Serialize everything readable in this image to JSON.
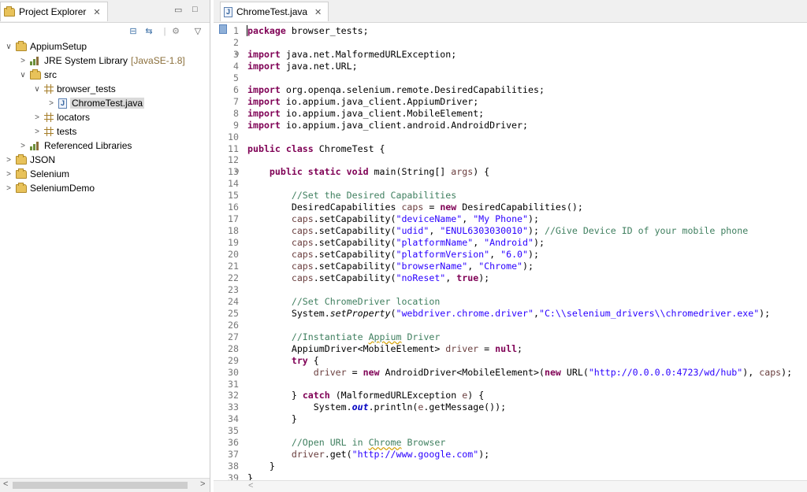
{
  "explorer": {
    "tab_label": "Project Explorer",
    "tree": [
      {
        "label": "AppiumSetup",
        "arrow": "∨",
        "type": "project",
        "depth": 0
      },
      {
        "label": "JRE System Library",
        "suffix": "[JavaSE-1.8]",
        "arrow": ">",
        "type": "library",
        "depth": 1
      },
      {
        "label": "src",
        "arrow": "∨",
        "type": "srcfolder",
        "depth": 1
      },
      {
        "label": "browser_tests",
        "arrow": "∨",
        "type": "package",
        "depth": 2
      },
      {
        "label": "ChromeTest.java",
        "arrow": ">",
        "type": "java",
        "depth": 3,
        "selected": true
      },
      {
        "label": "locators",
        "arrow": ">",
        "type": "package",
        "depth": 2
      },
      {
        "label": "tests",
        "arrow": ">",
        "type": "package",
        "depth": 2
      },
      {
        "label": "Referenced Libraries",
        "arrow": ">",
        "type": "library",
        "depth": 1
      },
      {
        "label": "JSON",
        "arrow": ">",
        "type": "project",
        "depth": 0
      },
      {
        "label": "Selenium",
        "arrow": ">",
        "type": "project",
        "depth": 0
      },
      {
        "label": "SeleniumDemo",
        "arrow": ">",
        "type": "project",
        "depth": 0
      }
    ]
  },
  "editor": {
    "tab_label": "ChromeTest.java",
    "lines": [
      {
        "n": "1",
        "html": "<span class=\"kw cursor\">package</span> browser_tests;"
      },
      {
        "n": "2",
        "html": ""
      },
      {
        "n": "3",
        "fold": "⊖",
        "html": "<span class=\"kw\">import</span> java.net.MalformedURLException;"
      },
      {
        "n": "4",
        "html": "<span class=\"kw\">import</span> java.net.URL;"
      },
      {
        "n": "5",
        "html": ""
      },
      {
        "n": "6",
        "html": "<span class=\"kw\">import</span> org.openqa.selenium.remote.DesiredCapabilities;"
      },
      {
        "n": "7",
        "html": "<span class=\"kw\">import</span> io.appium.java_client.AppiumDriver;"
      },
      {
        "n": "8",
        "html": "<span class=\"kw\">import</span> io.appium.java_client.MobileElement;"
      },
      {
        "n": "9",
        "html": "<span class=\"kw\">import</span> io.appium.java_client.android.AndroidDriver;"
      },
      {
        "n": "10",
        "html": ""
      },
      {
        "n": "11",
        "html": "<span class=\"kw\">public class</span> ChromeTest {"
      },
      {
        "n": "12",
        "html": ""
      },
      {
        "n": "13",
        "fold": "⊖",
        "html": "    <span class=\"kw\">public static void</span> main(String[] <span class=\"var\">args</span>) {"
      },
      {
        "n": "14",
        "html": ""
      },
      {
        "n": "15",
        "html": "        <span class=\"cm\">//Set the Desired Capabilities</span>"
      },
      {
        "n": "16",
        "html": "        DesiredCapabilities <span class=\"var\">caps</span> = <span class=\"kw\">new</span> DesiredCapabilities();"
      },
      {
        "n": "17",
        "html": "        <span class=\"var\">caps</span>.setCapability(<span class=\"str\">\"deviceName\"</span>, <span class=\"str\">\"My Phone\"</span>);"
      },
      {
        "n": "18",
        "html": "        <span class=\"var\">caps</span>.setCapability(<span class=\"str\">\"udid\"</span>, <span class=\"str\">\"ENUL6303030010\"</span>); <span class=\"cm\">//Give Device ID of your mobile phone</span>"
      },
      {
        "n": "19",
        "html": "        <span class=\"var\">caps</span>.setCapability(<span class=\"str\">\"platformName\"</span>, <span class=\"str\">\"Android\"</span>);"
      },
      {
        "n": "20",
        "html": "        <span class=\"var\">caps</span>.setCapability(<span class=\"str\">\"platformVersion\"</span>, <span class=\"str\">\"6.0\"</span>);"
      },
      {
        "n": "21",
        "html": "        <span class=\"var\">caps</span>.setCapability(<span class=\"str\">\"browserName\"</span>, <span class=\"str\">\"Chrome\"</span>);"
      },
      {
        "n": "22",
        "html": "        <span class=\"var\">caps</span>.setCapability(<span class=\"str\">\"noReset\"</span>, <span class=\"kw\">true</span>);"
      },
      {
        "n": "23",
        "html": ""
      },
      {
        "n": "24",
        "html": "        <span class=\"cm\">//Set ChromeDriver location</span>"
      },
      {
        "n": "25",
        "html": "        System.<span class=\"it\">setProperty</span>(<span class=\"str\">\"webdriver.chrome.driver\"</span>,<span class=\"str\">\"C:\\\\selenium_drivers\\\\chromedriver.exe\"</span>);"
      },
      {
        "n": "26",
        "html": ""
      },
      {
        "n": "27",
        "html": "        <span class=\"cm\">//Instantiate <span class=\"sp\">Appium</span> Driver</span>"
      },
      {
        "n": "28",
        "html": "        AppiumDriver&lt;MobileElement&gt; <span class=\"var\">driver</span> = <span class=\"kw\">null</span>;"
      },
      {
        "n": "29",
        "html": "        <span class=\"kw\">try</span> {"
      },
      {
        "n": "30",
        "html": "            <span class=\"var\">driver</span> = <span class=\"kw\">new</span> AndroidDriver&lt;MobileElement&gt;(<span class=\"kw\">new</span> URL(<span class=\"str\">\"http://0.0.0.0:4723/wd/hub\"</span>), <span class=\"var\">caps</span>);"
      },
      {
        "n": "31",
        "html": ""
      },
      {
        "n": "32",
        "html": "        } <span class=\"kw\">catch</span> (MalformedURLException <span class=\"var\">e</span>) {"
      },
      {
        "n": "33",
        "html": "            System.<span class=\"fld\">out</span>.println(<span class=\"var\">e</span>.getMessage());"
      },
      {
        "n": "34",
        "html": "        }"
      },
      {
        "n": "35",
        "html": ""
      },
      {
        "n": "36",
        "html": "        <span class=\"cm\">//Open URL in <span class=\"sp\">Chrome</span> Browser</span>"
      },
      {
        "n": "37",
        "html": "        <span class=\"var\">driver</span>.get(<span class=\"str\">\"http://www.google.com\"</span>);"
      },
      {
        "n": "38",
        "html": "    }"
      },
      {
        "n": "39",
        "html": "}"
      }
    ]
  }
}
